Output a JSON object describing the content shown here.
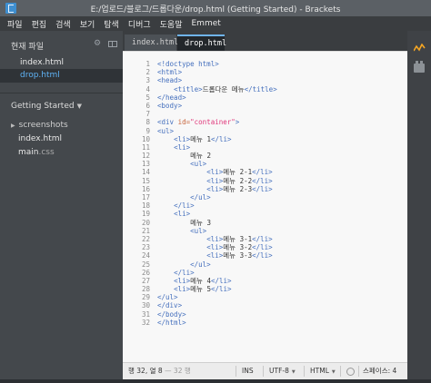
{
  "window": {
    "title": "E:/업로드/블로그/드롭다운/drop.html (Getting Started) - Brackets"
  },
  "menu": [
    "파일",
    "편집",
    "검색",
    "보기",
    "탐색",
    "디버그",
    "도움말",
    "Emmet"
  ],
  "sidebar": {
    "working_files_header": "현재 파일",
    "working_files": [
      "index.html",
      "drop.html"
    ],
    "active_file": "drop.html",
    "project_name": "Getting Started",
    "tree": [
      {
        "name": "screenshots",
        "type": "folder"
      },
      {
        "name": "index",
        "ext": ".html",
        "type": "file"
      },
      {
        "name": "main",
        "ext": ".css",
        "type": "file"
      }
    ]
  },
  "tabs": [
    "index.html",
    "drop.html"
  ],
  "active_tab": "drop.html",
  "editor": {
    "line_numbers": [
      "1",
      "2",
      "3",
      "4",
      "5",
      "6",
      "7",
      "8",
      "9",
      "10",
      "11",
      "12",
      "13",
      "14",
      "15",
      "16",
      "17",
      "18",
      "19",
      "20",
      "21",
      "22",
      "23",
      "24",
      "25",
      "26",
      "27",
      "28",
      "29",
      "30",
      "31",
      "32"
    ]
  },
  "status": {
    "position": "행 32, 열 8",
    "position_extra": "— 32 행",
    "insert_mode": "INS",
    "encoding": "UTF-8",
    "language": "HTML",
    "indent": "스페이스: 4"
  },
  "colors": {
    "tag": "#446fbd",
    "attribute": "#c7633a",
    "string": "#e0387b",
    "active_file": "#5fb3f5",
    "live_preview_icon": "#f5a623"
  }
}
